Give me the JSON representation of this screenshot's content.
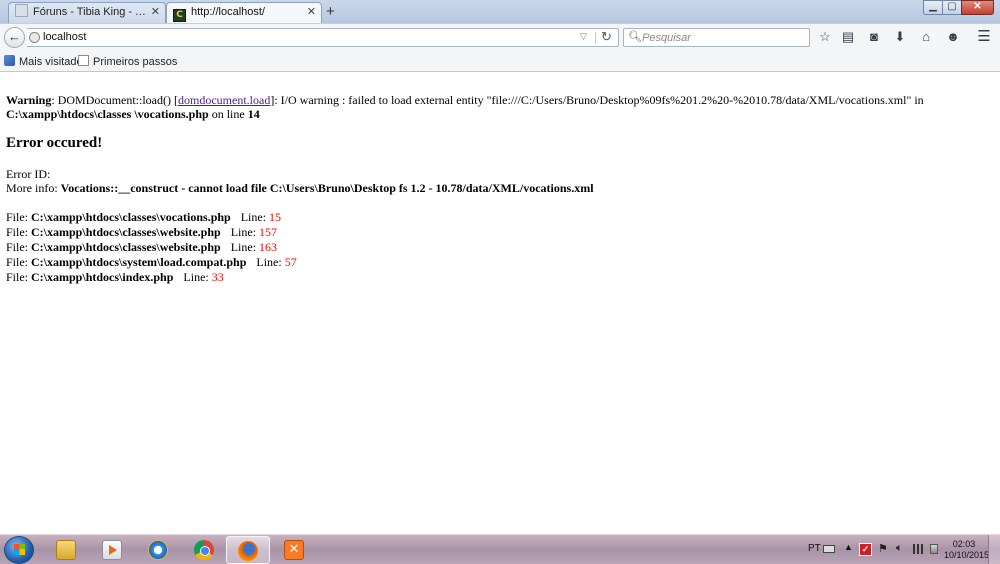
{
  "browser": {
    "tabs": [
      {
        "title": "Fóruns - Tibia King - Tudo sobr...",
        "active": false
      },
      {
        "title": "http://localhost/",
        "active": true
      }
    ],
    "new_tab_label": "+",
    "url": "localhost",
    "search_placeholder": "Pesquisar",
    "bookmarks": [
      {
        "label": "Mais visitados"
      },
      {
        "label": "Primeiros passos"
      }
    ]
  },
  "page": {
    "warning": {
      "label": "Warning",
      "text_before_link": ": DOMDocument::load() [",
      "link_text": "domdocument.load",
      "text_after_link": "]: I/O warning : failed to load external entity \"file:///C:/Users/Bruno/Desktop%09fs%201.2%20-%2010.78/data/XML/vocations.xml\" in ",
      "file": "C:\\xampp\\htdocs\\classes \\vocations.php",
      "on_line_text": " on line ",
      "line": "14"
    },
    "error_heading": "Error occured!",
    "error_id_label": "Error ID:",
    "more_info_label": "More info: ",
    "more_info_value": "Vocations::__construct - cannot load file C:\\Users\\Bruno\\Desktop fs 1.2 - 10.78/data/XML/vocations.xml",
    "trace_file_label": "File: ",
    "trace_line_label": "Line: ",
    "trace": [
      {
        "file": "C:\\xampp\\htdocs\\classes\\vocations.php",
        "line": "15"
      },
      {
        "file": "C:\\xampp\\htdocs\\classes\\website.php",
        "line": "157"
      },
      {
        "file": "C:\\xampp\\htdocs\\classes\\website.php",
        "line": "163"
      },
      {
        "file": "C:\\xampp\\htdocs\\system\\load.compat.php",
        "line": "57"
      },
      {
        "file": "C:\\xampp\\htdocs\\index.php",
        "line": "33"
      }
    ],
    "colors": {
      "line_number": "#ff0000",
      "link": "#551a8b"
    }
  },
  "taskbar": {
    "apps": [
      "windows-explorer",
      "media-center",
      "internet-explorer",
      "google-chrome",
      "firefox",
      "xampp"
    ],
    "tray": {
      "language": "PT",
      "time": "02:03",
      "date": "10/10/2015"
    }
  }
}
